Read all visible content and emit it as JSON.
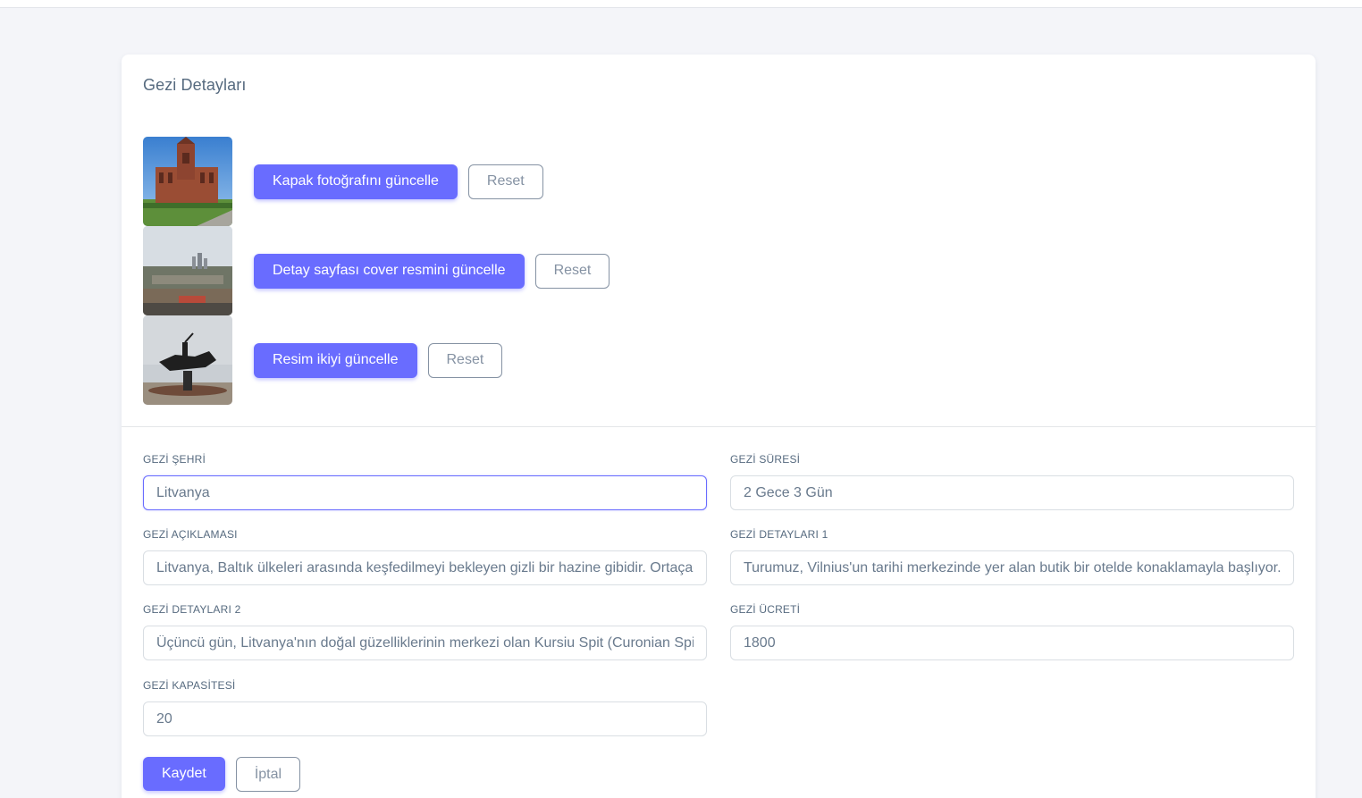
{
  "card": {
    "title": "Gezi Detayları"
  },
  "images": [
    {
      "button_label": "Kapak fotoğrafını güncelle",
      "reset_label": "Reset",
      "thumb": "church-photo"
    },
    {
      "button_label": "Detay sayfası cover resmini güncelle",
      "reset_label": "Reset",
      "thumb": "city-skyline-photo"
    },
    {
      "button_label": "Resim ikiyi güncelle",
      "reset_label": "Reset",
      "thumb": "horse-statue-photo"
    }
  ],
  "form": {
    "city": {
      "label": "GEZİ ŞEHRİ",
      "value": "Litvanya"
    },
    "duration": {
      "label": "GEZİ SÜRESİ",
      "value": "2 Gece 3 Gün"
    },
    "description": {
      "label": "GEZİ AÇIKLAMASI",
      "value": "Litvanya, Baltık ülkeleri arasında keşfedilmeyi bekleyen gizli bir hazine gibidir. Ortaçağ'"
    },
    "details1": {
      "label": "GEZİ DETAYLARI 1",
      "value": "Turumuz, Vilnius'un tarihi merkezinde yer alan butik bir otelde konaklamayla başlıyor. İl"
    },
    "details2": {
      "label": "GEZİ DETAYLARI 2",
      "value": "Üçüncü gün, Litvanya'nın doğal güzelliklerinin merkezi olan Kursiu Spit (Curonian Spit)"
    },
    "price": {
      "label": "GEZİ ÜCRETİ",
      "value": "1800"
    },
    "capacity": {
      "label": "GEZİ KAPASİTESİ",
      "value": "20"
    }
  },
  "actions": {
    "save_label": "Kaydet",
    "cancel_label": "İptal"
  },
  "colors": {
    "primary": "#696cff",
    "background": "#f4f5f9",
    "border": "#d9dee3",
    "secondary": "#8592a3"
  }
}
